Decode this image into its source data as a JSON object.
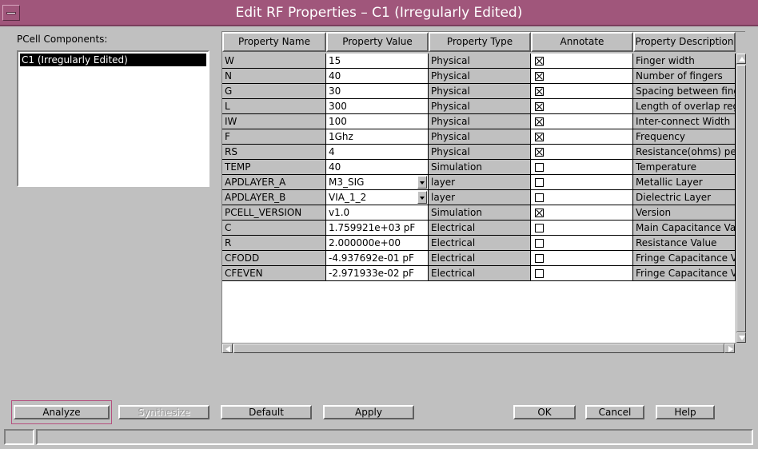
{
  "window": {
    "title": "Edit RF Properties – C1 (Irregularly Edited)"
  },
  "left_panel": {
    "label": "PCell Components:",
    "items": [
      {
        "label": "C1 (Irregularly Edited)",
        "selected": true
      }
    ]
  },
  "table": {
    "columns": [
      "Property Name",
      "Property Value",
      "Property Type",
      "Annotate",
      "Property Description"
    ],
    "rows": [
      {
        "name": "W",
        "value": "15",
        "type": "Physical",
        "annotate": true,
        "description": "Finger width",
        "dropdown": false
      },
      {
        "name": "N",
        "value": "40",
        "type": "Physical",
        "annotate": true,
        "description": "Number of fingers",
        "dropdown": false
      },
      {
        "name": "G",
        "value": "30",
        "type": "Physical",
        "annotate": true,
        "description": "Spacing between finge",
        "dropdown": false
      },
      {
        "name": "L",
        "value": "300",
        "type": "Physical",
        "annotate": true,
        "description": "Length of overlap regi",
        "dropdown": false
      },
      {
        "name": "IW",
        "value": "100",
        "type": "Physical",
        "annotate": true,
        "description": "Inter-connect Width",
        "dropdown": false
      },
      {
        "name": "F",
        "value": "1Ghz",
        "type": "Physical",
        "annotate": true,
        "description": "Frequency",
        "dropdown": false
      },
      {
        "name": "RS",
        "value": "4",
        "type": "Physical",
        "annotate": true,
        "description": "Resistance(ohms) per",
        "dropdown": false
      },
      {
        "name": "TEMP",
        "value": "40",
        "type": "Simulation",
        "annotate": false,
        "description": "Temperature",
        "dropdown": false
      },
      {
        "name": "APDLAYER_A",
        "value": "M3_SIG",
        "type": "layer",
        "annotate": false,
        "description": "Metallic Layer",
        "dropdown": true
      },
      {
        "name": "APDLAYER_B",
        "value": "VIA_1_2",
        "type": "layer",
        "annotate": false,
        "description": "Dielectric Layer",
        "dropdown": true
      },
      {
        "name": "PCELL_VERSION",
        "value": "v1.0",
        "type": "Simulation",
        "annotate": true,
        "description": "Version",
        "dropdown": false
      },
      {
        "name": "C",
        "value": "1.759921e+03 pF",
        "type": "Electrical",
        "annotate": false,
        "description": "Main Capacitance Va",
        "dropdown": false
      },
      {
        "name": "R",
        "value": "2.000000e+00",
        "type": "Electrical",
        "annotate": false,
        "description": "Resistance Value",
        "dropdown": false
      },
      {
        "name": "CFODD",
        "value": "-4.937692e-01 pF",
        "type": "Electrical",
        "annotate": false,
        "description": "Fringe Capacitance V",
        "dropdown": false
      },
      {
        "name": "CFEVEN",
        "value": "-2.971933e-02 pF",
        "type": "Electrical",
        "annotate": false,
        "description": "Fringe Capacitance V",
        "dropdown": false
      }
    ]
  },
  "buttons": {
    "analyze": "Analyze",
    "synthesize": "Synthesize",
    "default": "Default",
    "apply": "Apply",
    "ok": "OK",
    "cancel": "Cancel",
    "help": "Help"
  },
  "icons": {
    "window_menu": "window-menu-icon",
    "scroll_up": "arrow-up-icon",
    "scroll_down": "arrow-down-icon",
    "scroll_left": "arrow-left-icon",
    "scroll_right": "arrow-right-icon",
    "dropdown": "chevron-down-icon",
    "checkbox_checked": "checked-box-icon",
    "checkbox_unchecked": "unchecked-box-icon"
  },
  "colors": {
    "titlebar": "#a0567b",
    "window_bg": "#c0c0c0",
    "focus_ring": "#b5507f"
  }
}
